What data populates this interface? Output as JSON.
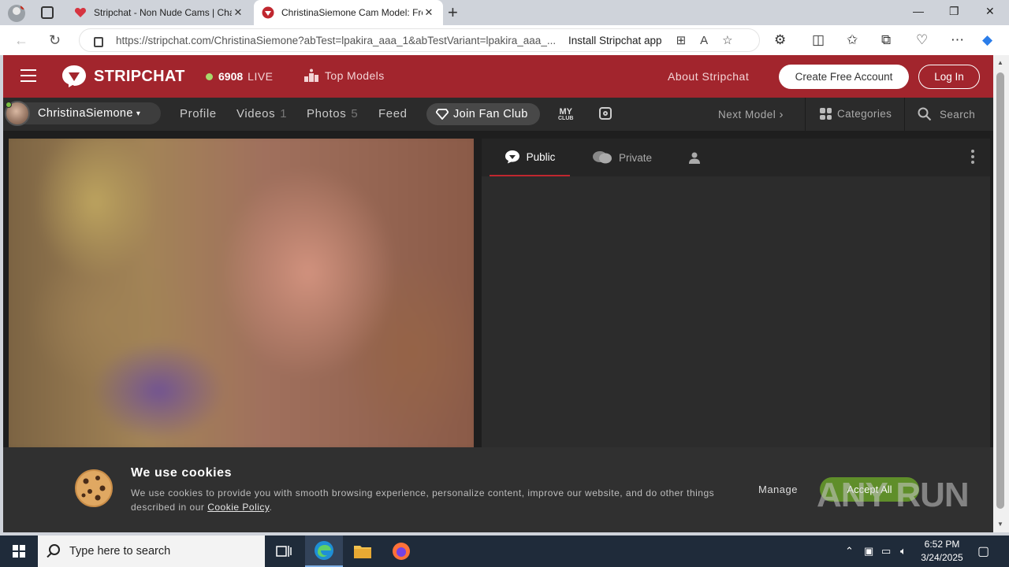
{
  "browser": {
    "tabs": [
      {
        "title": "Stripchat - Non Nude Cams | Chat",
        "close": "✕"
      },
      {
        "title": "ChristinaSiemone Cam Model: Free",
        "close": "✕"
      }
    ],
    "new_tab": "+",
    "window_controls": {
      "minimize": "—",
      "restore": "❐",
      "close": "✕"
    },
    "url": "https://stripchat.com/ChristinaSiemone?abTest=lpakira_aaa_1&abTestVariant=lpakira_aaa_...",
    "install_label": "Install Stripchat app"
  },
  "site": {
    "logo_text": "STRIPCHAT",
    "live_count": "6908",
    "live_label": "LIVE",
    "top_models": "Top Models",
    "about": "About Stripchat",
    "create_account": "Create Free Account",
    "login": "Log In"
  },
  "subnav": {
    "model_name": "ChristinaSiemone",
    "profile": "Profile",
    "videos": "Videos",
    "videos_count": "1",
    "photos": "Photos",
    "photos_count": "5",
    "feed": "Feed",
    "fan_club": "Join Fan Club",
    "myclub_line1": "MY",
    "myclub_line2": "CLUB",
    "next_model": "Next Model",
    "categories": "Categories",
    "search": "Search"
  },
  "chat": {
    "tabs": {
      "public": "Public",
      "private": "Private"
    }
  },
  "cookie": {
    "title": "We use cookies",
    "text": "We use cookies to provide you with smooth browsing experience, personalize content, improve our website, and do other things described in our ",
    "policy_link": "Cookie Policy",
    "text_end": ".",
    "manage": "Manage",
    "accept": "Accept All"
  },
  "watermark": "ANY RUN",
  "taskbar": {
    "search_placeholder": "Type here to search",
    "time": "6:52 PM",
    "date": "3/24/2025"
  },
  "colors": {
    "brand_red": "#a2252d",
    "accept_green": "#5f8e2a",
    "live_green": "#a8d86b"
  }
}
